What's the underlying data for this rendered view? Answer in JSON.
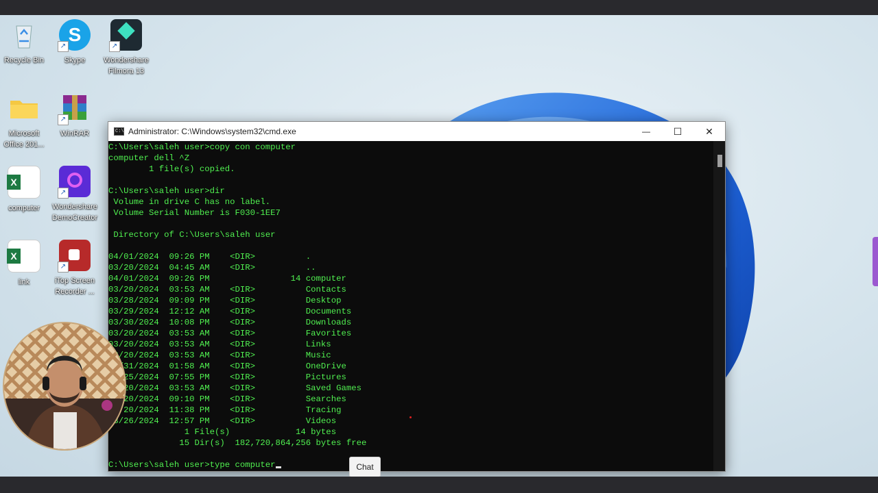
{
  "desktop": {
    "icons": [
      {
        "label": "Recycle Bin",
        "icon": "recycle-bin-icon"
      },
      {
        "label": "Skype",
        "icon": "skype-icon"
      },
      {
        "label": "Wondershare Filmora 13",
        "icon": "filmora-icon"
      },
      {
        "label": "Microsoft Office 201...",
        "icon": "folder-icon"
      },
      {
        "label": "WinRAR",
        "icon": "winrar-icon"
      },
      {
        "label": "computer",
        "icon": "excel-icon"
      },
      {
        "label": "Wondershare DemoCreator",
        "icon": "democreator-icon"
      },
      {
        "label": "link",
        "icon": "excel-icon"
      },
      {
        "label": "iTop Screen Recorder ...",
        "icon": "itop-recorder-icon"
      }
    ]
  },
  "window": {
    "title": "Administrator: C:\\Windows\\system32\\cmd.exe",
    "minimize_glyph": "—",
    "maximize_glyph": "☐",
    "close_glyph": "✕"
  },
  "console": {
    "lines": [
      "C:\\Users\\saleh user>copy con computer",
      "computer dell ^Z",
      "        1 file(s) copied.",
      "",
      "C:\\Users\\saleh user>dir",
      " Volume in drive C has no label.",
      " Volume Serial Number is F030-1EE7",
      "",
      " Directory of C:\\Users\\saleh user",
      "",
      "04/01/2024  09:26 PM    <DIR>          .",
      "03/20/2024  04:45 AM    <DIR>          ..",
      "04/01/2024  09:26 PM                14 computer",
      "03/20/2024  03:53 AM    <DIR>          Contacts",
      "03/28/2024  09:09 PM    <DIR>          Desktop",
      "03/29/2024  12:12 AM    <DIR>          Documents",
      "03/30/2024  10:08 PM    <DIR>          Downloads",
      "03/20/2024  03:53 AM    <DIR>          Favorites",
      "03/20/2024  03:53 AM    <DIR>          Links",
      "03/20/2024  03:53 AM    <DIR>          Music",
      "03/31/2024  01:58 AM    <DIR>          OneDrive",
      "03/25/2024  07:55 PM    <DIR>          Pictures",
      "03/20/2024  03:53 AM    <DIR>          Saved Games",
      "03/20/2024  09:10 PM    <DIR>          Searches",
      "03/20/2024  11:38 PM    <DIR>          Tracing",
      "03/26/2024  12:57 PM    <DIR>          Videos",
      "               1 File(s)             14 bytes",
      "              15 Dir(s)  182,720,864,256 bytes free",
      "",
      "C:\\Users\\saleh user>type computer"
    ]
  },
  "overlay": {
    "chat_label": "Chat"
  }
}
